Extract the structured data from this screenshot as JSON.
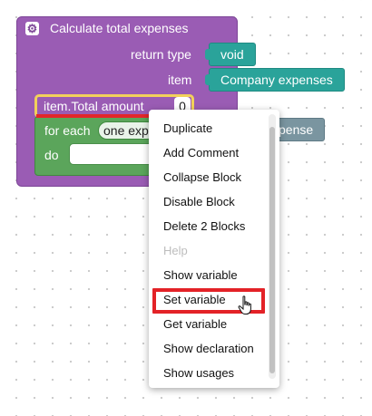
{
  "procedure": {
    "title": "Calculate total expenses",
    "return_type_label": "return type",
    "return_type_value": "void",
    "item_label": "item",
    "item_value": "Company expenses"
  },
  "set_block": {
    "label": "item.Total amount",
    "value": "0"
  },
  "for_each": {
    "label": "for each",
    "variable": "one expense",
    "do_label": "do"
  },
  "background_block": {
    "label": "pense"
  },
  "context_menu": {
    "items": [
      {
        "label": "Duplicate",
        "disabled": false
      },
      {
        "label": "Add Comment",
        "disabled": false
      },
      {
        "label": "Collapse Block",
        "disabled": false
      },
      {
        "label": "Disable Block",
        "disabled": false
      },
      {
        "label": "Delete 2 Blocks",
        "disabled": false
      },
      {
        "label": "Help",
        "disabled": true
      },
      {
        "label": "Show variable",
        "disabled": false
      },
      {
        "label": "Set variable",
        "disabled": false,
        "highlighted": true
      },
      {
        "label": "Get variable",
        "disabled": false
      },
      {
        "label": "Show declaration",
        "disabled": false
      },
      {
        "label": "Show usages",
        "disabled": false
      }
    ]
  },
  "colors": {
    "procedure": "#9a5cb4",
    "value_block": "#2aa39a",
    "loop_block": "#5ba55b",
    "selection_outline": "#f2d15a",
    "highlight": "#e32227"
  }
}
